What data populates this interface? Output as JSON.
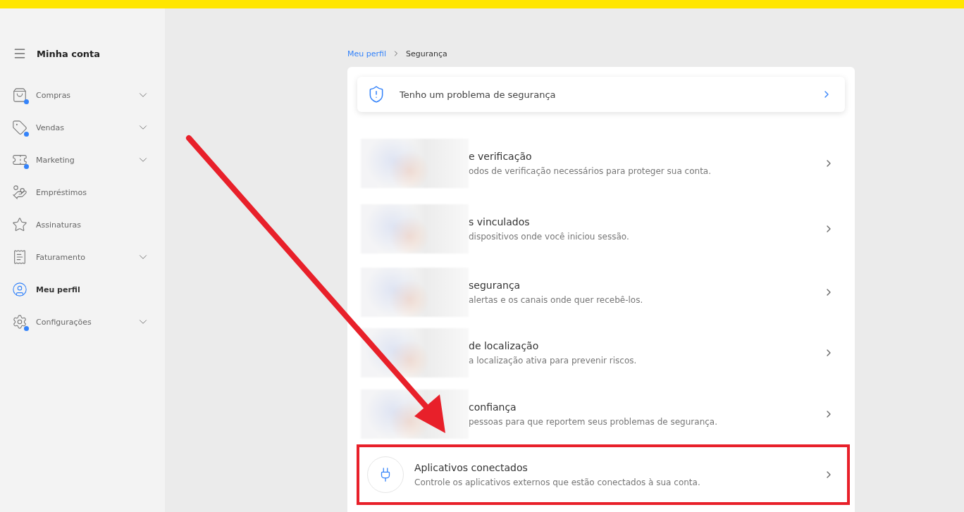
{
  "sidebar": {
    "title": "Minha conta",
    "items": [
      {
        "label": "Compras",
        "expandable": true,
        "badge": true,
        "selected": false
      },
      {
        "label": "Vendas",
        "expandable": true,
        "badge": true,
        "selected": false
      },
      {
        "label": "Marketing",
        "expandable": true,
        "badge": true,
        "selected": false
      },
      {
        "label": "Empréstimos",
        "expandable": false,
        "badge": false,
        "selected": false
      },
      {
        "label": "Assinaturas",
        "expandable": false,
        "badge": false,
        "selected": false
      },
      {
        "label": "Faturamento",
        "expandable": true,
        "badge": false,
        "selected": false
      },
      {
        "label": "Meu perfil",
        "expandable": false,
        "badge": false,
        "selected": true
      },
      {
        "label": "Configurações",
        "expandable": true,
        "badge": true,
        "selected": false
      }
    ]
  },
  "breadcrumb": [
    {
      "label": "Meu perfil",
      "kind": "link"
    },
    {
      "label": "Segurança",
      "kind": "current"
    }
  ],
  "alert_card": {
    "label": "Tenho um problema de segurança"
  },
  "options": [
    {
      "kind": "blurred",
      "title": "e verificação",
      "description": "odos de verificação necessários para proteger sua conta.",
      "highlighted": false
    },
    {
      "kind": "blurred",
      "title": "s vinculados",
      "description": "dispositivos onde você iniciou sessão.",
      "highlighted": false
    },
    {
      "kind": "blurred",
      "title": "segurança",
      "description": "alertas e os canais onde quer recebê-los.",
      "highlighted": false
    },
    {
      "kind": "blurred",
      "title": "de localização",
      "description": "a localização ativa para prevenir riscos.",
      "highlighted": false
    },
    {
      "kind": "blurred",
      "title": "confiança",
      "description": "pessoas para que reportem seus problemas de segurança.",
      "highlighted": false
    },
    {
      "kind": "normal",
      "title": "Aplicativos conectados",
      "description": "Controle os aplicativos externos que estão conectados à sua conta.",
      "highlighted": true
    }
  ]
}
